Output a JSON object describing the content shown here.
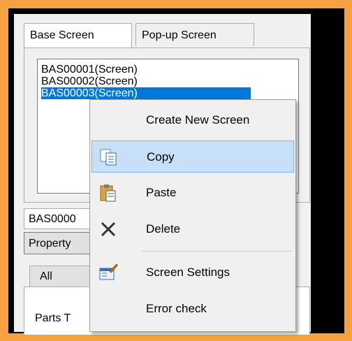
{
  "tabs": {
    "base_screen": "Base Screen",
    "popup_screen": "Pop-up Screen"
  },
  "screen_list": {
    "items": [
      "BAS00001(Screen)",
      "BAS00002(Screen)",
      "BAS00003(Screen)"
    ],
    "selected_index": 2
  },
  "lower_panel": {
    "screen_label": "BAS0000",
    "property_tab": "Property",
    "all_tab": "All",
    "parts_label": "Parts T"
  },
  "context_menu": {
    "items": [
      {
        "label": "Create New Screen",
        "icon": "none"
      },
      {
        "label": "Copy",
        "icon": "copy-icon"
      },
      {
        "label": "Paste",
        "icon": "paste-icon"
      },
      {
        "label": "Delete",
        "icon": "delete-x-icon"
      },
      {
        "label": "Screen Settings",
        "icon": "screen-settings-icon"
      },
      {
        "label": "Error check",
        "icon": "none"
      }
    ],
    "hovered_index": 1
  },
  "colors": {
    "border_accent": "#f7a241",
    "selection": "#0078d7",
    "menu_hover": "#c7dff7"
  }
}
